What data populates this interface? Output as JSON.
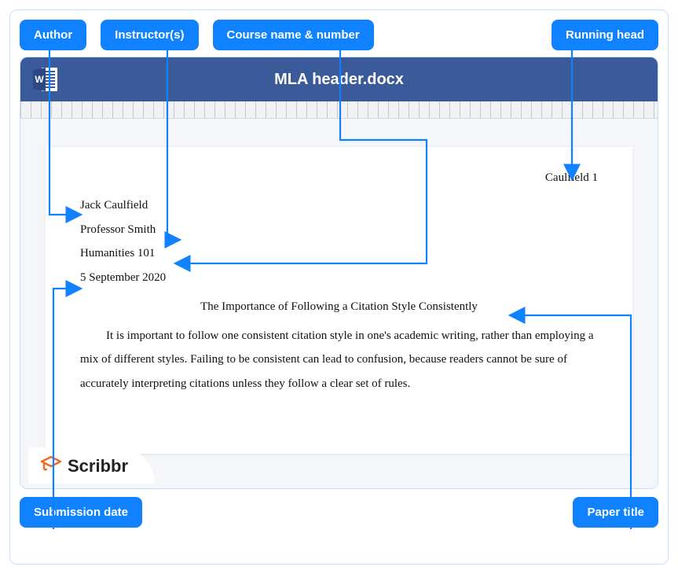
{
  "labels": {
    "author": "Author",
    "instructors": "Instructor(s)",
    "course": "Course name & number",
    "running_head": "Running head",
    "submission_date": "Submission date",
    "paper_title": "Paper title"
  },
  "titlebar": {
    "filename": "MLA header.docx"
  },
  "document": {
    "running_head": "Caulfield 1",
    "author": "Jack Caulfield",
    "instructor": "Professor Smith",
    "course": "Humanities 101",
    "date": "5 September 2020",
    "title": "The Importance of Following a Citation Style Consistently",
    "body": "It is important to follow one consistent citation style in one's academic writing, rather than employing a mix of different styles. Failing to be consistent can lead to confusion, because readers cannot be sure of accurately interpreting citations unless they follow a clear set of rules."
  },
  "brand": "Scribbr",
  "colors": {
    "accent": "#1182ff",
    "titlebar": "#3a5a9a",
    "brand_orange": "#f06a26"
  }
}
